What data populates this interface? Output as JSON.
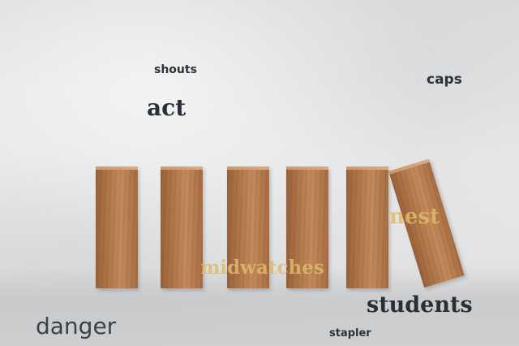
{
  "words": {
    "shouts": "shouts",
    "act": "act",
    "caps": "caps",
    "nest": "nest",
    "midwatches": "midwatches",
    "students": "students",
    "danger": "danger",
    "stapler": "stapler"
  },
  "colors": {
    "background": "#e9eaeb",
    "wood": "#b47a4d",
    "dark_text": "#2c3338",
    "gold_text": "#deba6c"
  }
}
